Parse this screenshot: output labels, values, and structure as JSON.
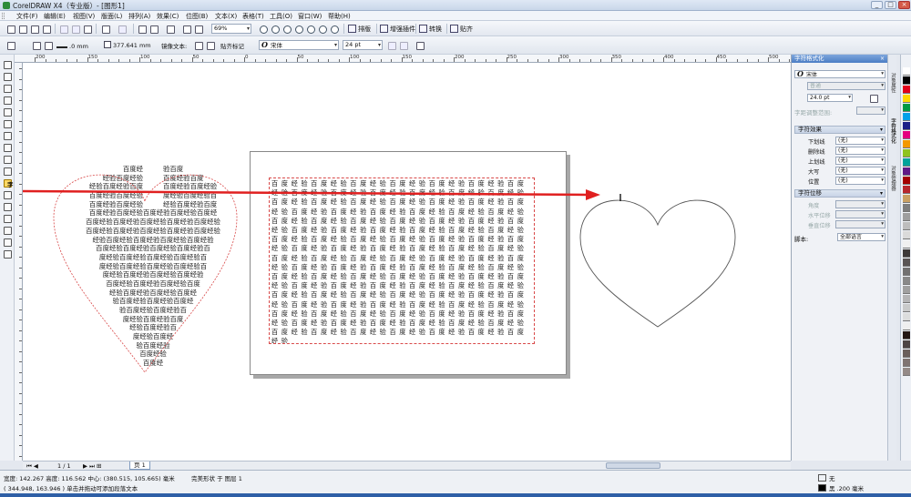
{
  "window": {
    "title": "CorelDRAW X4（专业版）- [图形1]",
    "controls": [
      "_",
      "□",
      "×"
    ]
  },
  "menu": [
    "文件(F)",
    "编辑(E)",
    "视图(V)",
    "版面(L)",
    "排列(A)",
    "效果(C)",
    "位图(B)",
    "文本(X)",
    "表格(T)",
    "工具(O)",
    "窗口(W)",
    "帮助(H)"
  ],
  "toolbar": {
    "zoom": "69%",
    "arrange_label": "排版",
    "plugin_label": "增强插件",
    "convert_label": "转换",
    "paste_label": "贴齐"
  },
  "propbar": {
    "line_width": ".0 mm",
    "distance": "377.641 mm",
    "mirror_text_label": "镜像文本:",
    "snap_mark_label": "贴齐标记",
    "font_name": "宋体",
    "font_size": "24 pt"
  },
  "ruler": {
    "labels": [
      "200",
      "150",
      "100",
      "50",
      "0",
      "50",
      "100",
      "150",
      "200",
      "250",
      "300",
      "350",
      "400",
      "450",
      "500"
    ]
  },
  "canvas": {
    "frame_text": "百度经验百度经验百度经验百度经验百度经验百度经验百度经验百度经验百度经验百度经验百度经验百度经验百度经验百度经验百度经验百度经验百度经验百度经验百度经验百度经验百度经验百度经验百度经验百度经验百度经验百度经验百度经验百度经验百度经验百度经验百度经验百度经验百度经验百度经验百度经验百度经验百度经验百度经验百度经验百度经验百度经验百度经验百度经验百度经验百度经验百度经验百度经验百度经验百度经验百度经验百度经验百度经验百度经验百度经验百度经验百度经验百度经验百度经验百度经验百度经验百度经验百度经验百度经验百度经验百度经验百度经验百度经验百度经验百度经验百度经验百度经验百度经验百度经验百度经验百度经验百度经验百度经验百度经验百度经验百度经验百度经验百度经验百度经验百度经验百度经验百度经验百度经验百度经验百度经验百度经验百度经验百度经验百度经验百度经验百度经验百度经验百度经验百度经验百度经验百度经验百度经验百度经验百度经验百度经验百度经验百度经验百度经验百度经验百度经验百度经验百度经验",
    "heart_top_left": [
      "百度经",
      "经验百度经验",
      "经验百度经验百度",
      "百度经验百度经验",
      "百度经验百度经验"
    ],
    "heart_top_right": [
      "验百度",
      "百度经验百度",
      "百度经验百度经验",
      "度经验百度经验百",
      "经验百度经验百度"
    ],
    "heart_lines": [
      "百度经验百度经验百度经验百度经验百度经",
      "百度经验百度经验百度经验百度经验百度经验",
      "百度经验百度经验百度经验百度经验百度经验",
      "经验百度经验百度经验百度经验百度经验",
      "百度经验百度经验百度经验百度经验百",
      "度经验百度经验百度经验百度经验百",
      "度经验百度经验百度经验百度经验百",
      "度经验百度经验百度经验百度经验",
      "百度经验百度经验百度经验百度",
      "经验百度经验百度经验百度经",
      "验百度经验百度经验百度经",
      "验百度经验百度经验百",
      "度经验百度经验百度",
      "经验百度经验百",
      "度经验百度经",
      "验百度经验",
      "百度经验",
      "百度经"
    ]
  },
  "docker": {
    "title": "字符格式化",
    "font_name": "宋体",
    "font_style": "普通",
    "font_size": "24.0 pt",
    "kerning_label": "字距调整范围:",
    "effects_label": "字符效果",
    "effects": [
      {
        "label": "下划线",
        "value": "(无)"
      },
      {
        "label": "删除线",
        "value": "(无)"
      },
      {
        "label": "上划线",
        "value": "(无)"
      },
      {
        "label": "大写",
        "value": "(无)"
      },
      {
        "label": "位置",
        "value": "(无)"
      }
    ],
    "shift_label": "字符位移",
    "shifts": [
      {
        "label": "角度"
      },
      {
        "label": "水平位移"
      },
      {
        "label": "垂直位移"
      }
    ],
    "script_label": "脚本:",
    "script_value": "全部语言"
  },
  "side_tabs": [
    "对象属性",
    "字符格式化",
    "对象管理器"
  ],
  "palette": [
    "#ffffff",
    "#000000",
    "#e2001a",
    "#ffd800",
    "#009a44",
    "#00a0e9",
    "#1d2088",
    "#e4007f",
    "#f39800",
    "#8fc31f",
    "#00a29a",
    "#601986",
    "#a40000",
    "#b7282e",
    "#c9a063",
    "#7d7d7d",
    "#9e9e9e",
    "#bdbdbd",
    "#dadada",
    "#f0f0f0",
    "#3e3a39",
    "#5a5555",
    "#727171",
    "#898989",
    "#a0a0a0",
    "#b5b5b6",
    "#c9caca",
    "#dcdddd",
    "#efefef",
    "#231815",
    "#4d4544",
    "#6a5f5c",
    "#7f7472",
    "#958b88"
  ],
  "page_nav": {
    "counter": "1 / 1",
    "page_tab": "页 1"
  },
  "status": {
    "line1": "宽度: 142.267  高度: 116.562  中心: (380.515, 105.665)  毫米",
    "line2": "( 344.948, 163.946 )    单击并拖动可添加段落文本",
    "object_info": "完美形状 于 图层 1",
    "fill_none": "无",
    "outline": "黑  .200 毫米"
  }
}
